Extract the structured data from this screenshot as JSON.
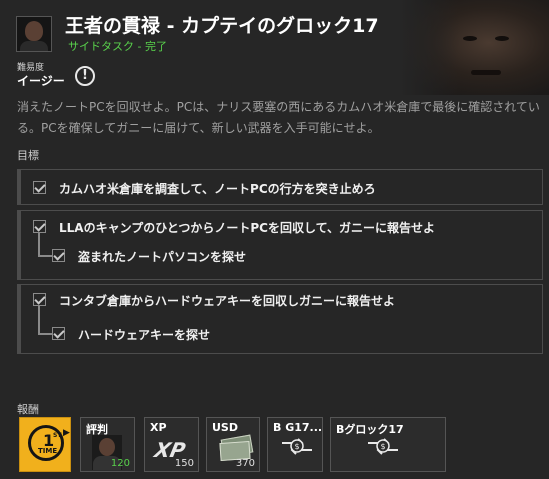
{
  "mission": {
    "title": "王者の貫禄 - カプテイのグロック17",
    "subtitle": "サイドタスク - 完了"
  },
  "difficulty": {
    "label": "難易度",
    "value": "イージー",
    "icon": "warning-icon"
  },
  "description": "消えたノートPCを回収せよ。PCは、ナリス要塞の西にあるカムハオ米倉庫で最後に確認されている。PCを確保してガニーに届けて、新しい武器を入手可能にせよ。",
  "objectives": {
    "label": "目標",
    "groups": [
      {
        "main": "カムハオ米倉庫を調査して、ノートPCの行方を突き止めろ",
        "completed": true,
        "sub": []
      },
      {
        "main": "LLAのキャンプのひとつからノートPCを回収して、ガニーに報告せよ",
        "completed": true,
        "sub": [
          "盗まれたノートパソコンを探せ"
        ]
      },
      {
        "main": "コンタブ倉庫からハードウェアキーを回収しガニーに報告せよ",
        "completed": true,
        "sub": [
          "ハードウェアキーを探せ"
        ]
      }
    ]
  },
  "rewards": {
    "label": "報酬",
    "first_time": {
      "one": "1",
      "st": "ST",
      "time": "TIME"
    },
    "items": [
      {
        "label": "評判",
        "value": "120",
        "icon": "portrait-icon",
        "value_color": "#59d24c"
      },
      {
        "label": "XP",
        "value": "150",
        "icon": "xp-icon"
      },
      {
        "label": "USD",
        "value": "370",
        "icon": "cash-icon"
      },
      {
        "label": "B G17...",
        "value": "",
        "icon": "swap-icon"
      },
      {
        "label": "Bグロック17",
        "value": "",
        "icon": "swap-icon"
      }
    ]
  },
  "colors": {
    "accent_green": "#59d24c",
    "first_time_yellow": "#f1b01c",
    "background": "#262626"
  }
}
